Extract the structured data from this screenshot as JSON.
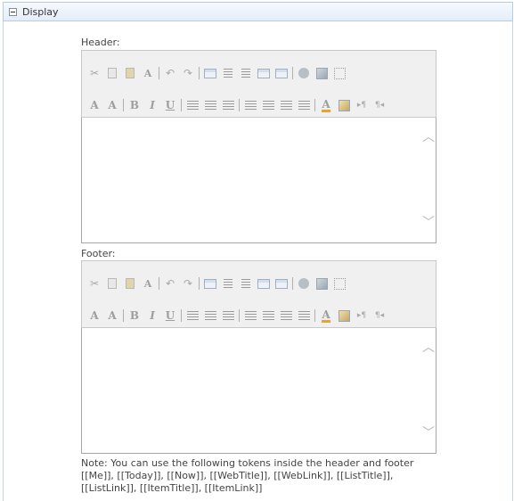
{
  "section": {
    "title": "Display",
    "toggle_icon": "collapse-minus-icon"
  },
  "header_editor": {
    "label": "Header:",
    "content": ""
  },
  "footer_editor": {
    "label": "Footer:",
    "content": ""
  },
  "toolbar": {
    "row1": [
      "cut-icon",
      "copy-icon",
      "paste-icon",
      "spellcheck-icon",
      "undo-icon",
      "redo-icon",
      "insert-table-icon",
      "insert-row-above-icon",
      "insert-row-below-icon",
      "table-properties-icon",
      "cell-properties-icon",
      "insert-link-icon",
      "insert-image-icon",
      "insert-placeholder-icon"
    ],
    "row2": [
      "font-size-icon",
      "font-style-icon",
      "bold-icon",
      "italic-icon",
      "underline-icon",
      "align-left-icon",
      "align-center-icon",
      "align-right-icon",
      "numbered-list-icon",
      "bullet-list-icon",
      "decrease-indent-icon",
      "increase-indent-icon",
      "font-color-icon",
      "highlight-color-icon",
      "ltr-icon",
      "rtl-icon"
    ],
    "glyphs": {
      "font_size": "A",
      "font_style": "A",
      "bold": "B",
      "italic": "I",
      "underline": "U",
      "font_color": "A",
      "ltr": "▸¶",
      "rtl": "¶◂"
    }
  },
  "scroll": {
    "up": "︿",
    "down": "﹀"
  },
  "note": "Note: You can use the following tokens inside the header and footer [[Me]], [[Today]], [[Now]], [[WebTitle]], [[WebLink]], [[ListTitle]], [[ListLink]], [[ItemTitle]], [[ItemLink]]"
}
